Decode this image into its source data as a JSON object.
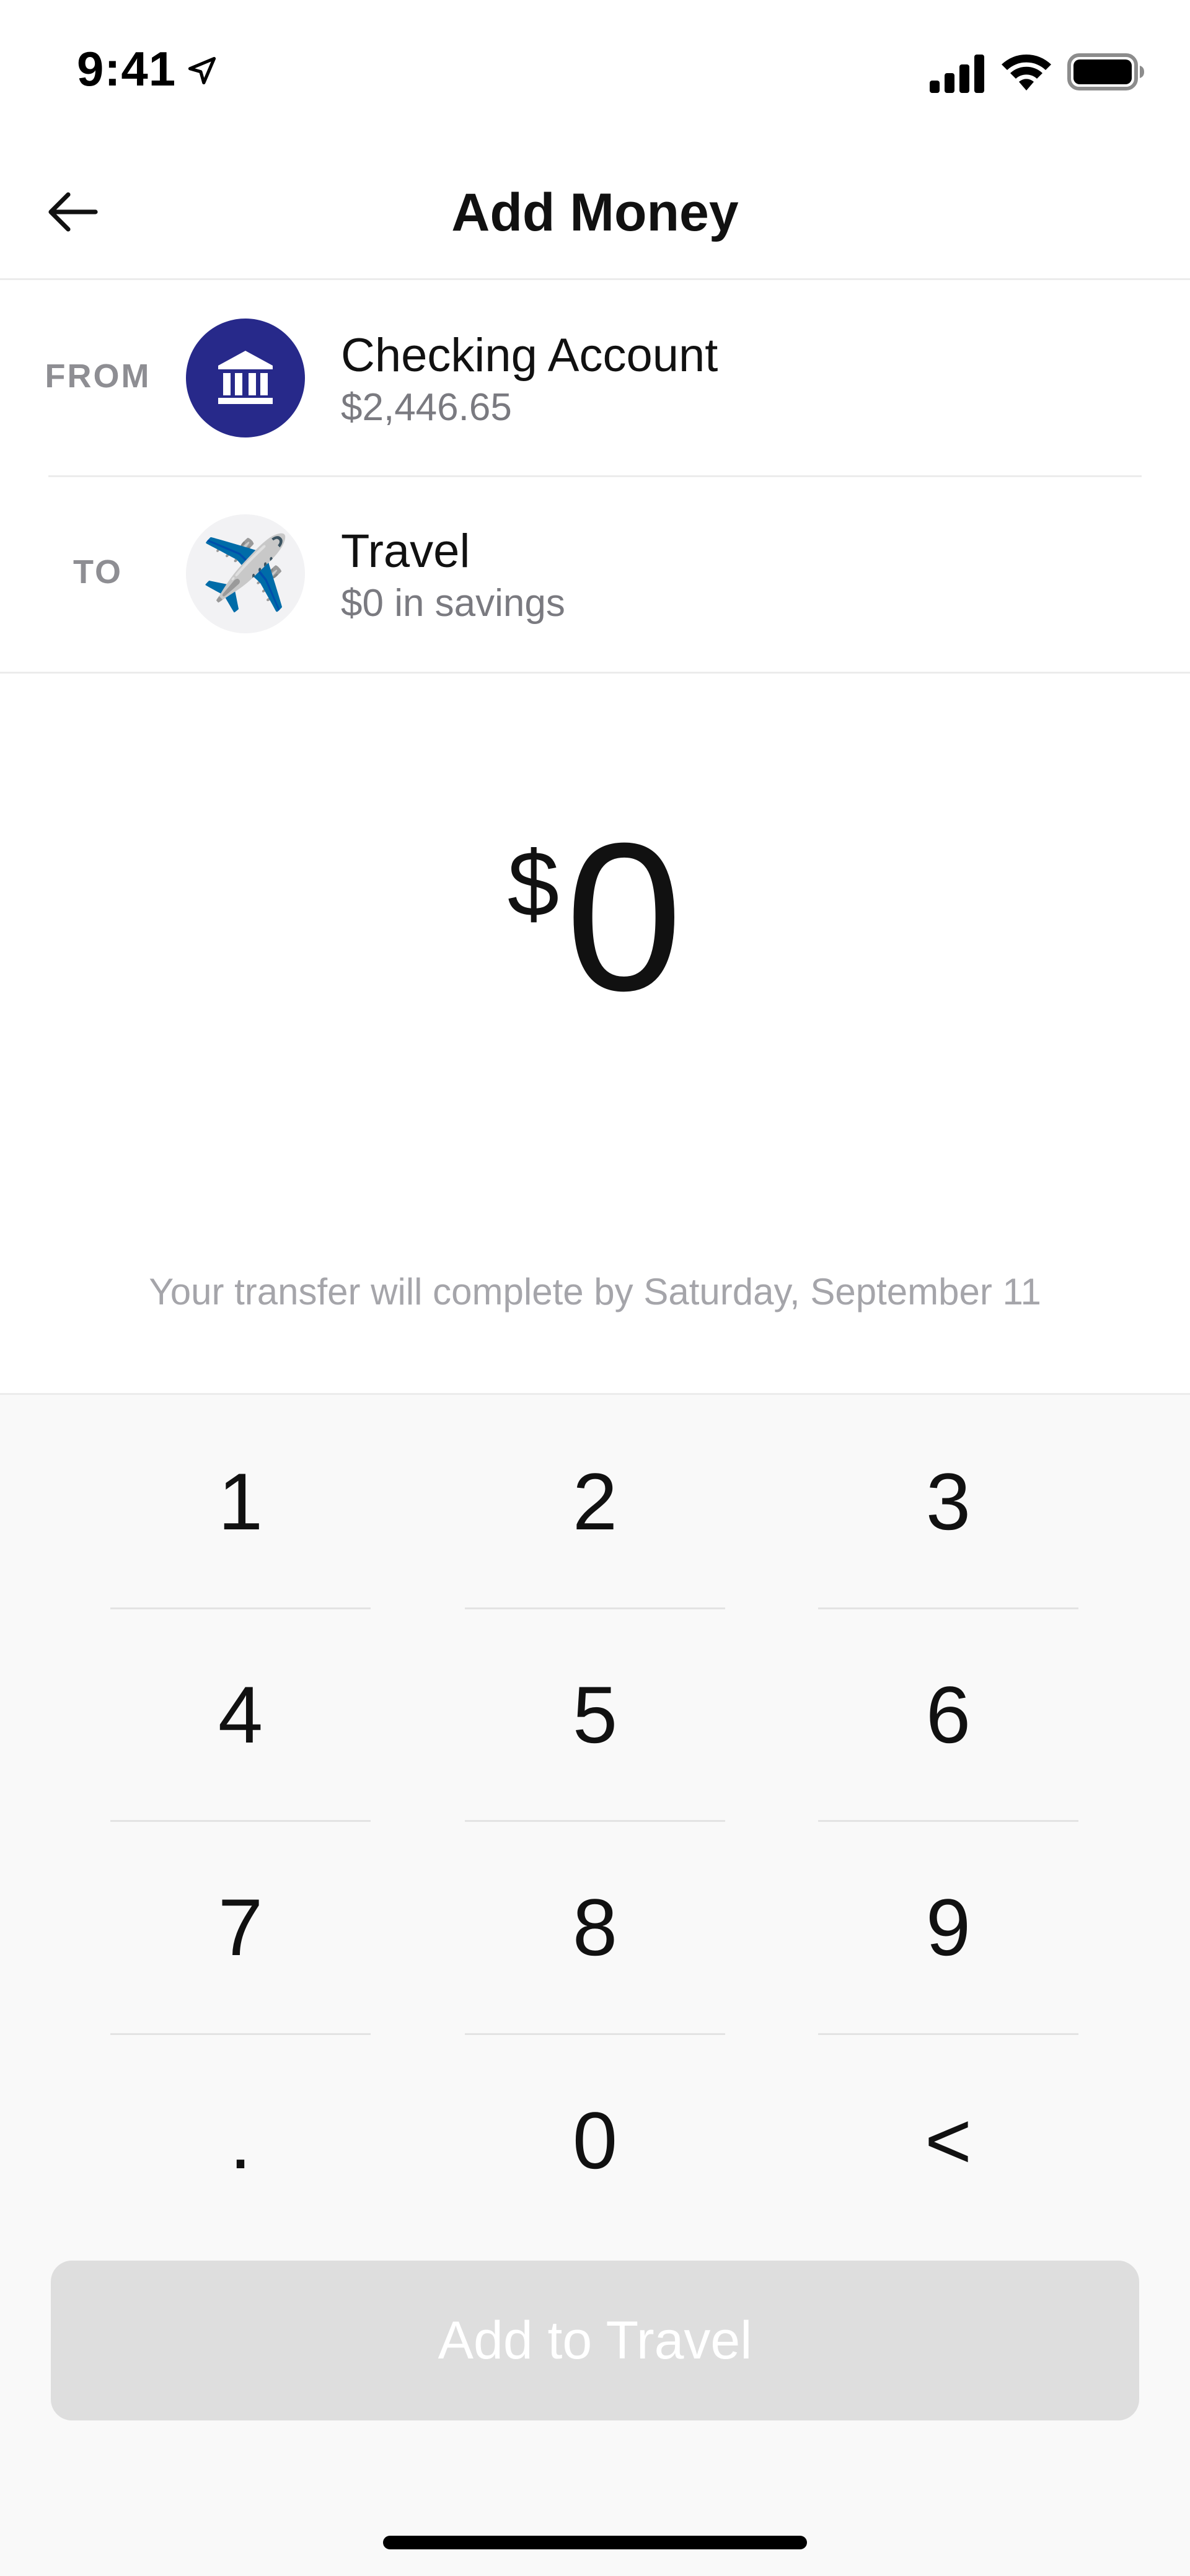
{
  "status_bar": {
    "time": "9:41"
  },
  "nav": {
    "title": "Add Money"
  },
  "from": {
    "label": "FROM",
    "account_name": "Checking Account",
    "balance": "$2,446.65",
    "icon": "bank-icon",
    "icon_color": "#27298a"
  },
  "to": {
    "label": "TO",
    "account_name": "Travel",
    "balance": "$0 in savings",
    "icon": "airplane-emoji",
    "emoji": "✈️"
  },
  "amount": {
    "currency": "$",
    "value": "0"
  },
  "transfer_note": "Your transfer will complete by Saturday, September 11",
  "keypad": {
    "keys": [
      "1",
      "2",
      "3",
      "4",
      "5",
      "6",
      "7",
      "8",
      "9",
      ".",
      "0",
      "<"
    ]
  },
  "cta": {
    "label": "Add to Travel"
  },
  "colors": {
    "accent": "#27298a",
    "cta_disabled_bg": "#dedede",
    "keypad_bg": "#f9f9f9"
  }
}
